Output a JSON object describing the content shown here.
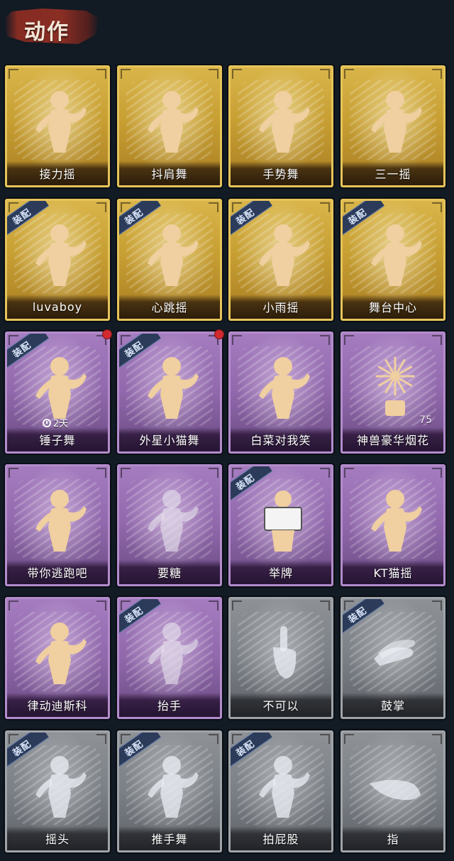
{
  "header": {
    "title": "动作"
  },
  "colors": {
    "gold": "#d9b54a",
    "purple": "#9a72b5",
    "gray": "#868b91",
    "badge": "#2b3b59",
    "alert": "#d12a2f"
  },
  "badge_label": "装配",
  "cards": [
    {
      "label": "接力摇",
      "tier": "gold",
      "equipped": false,
      "icon": "dance-figure-icon"
    },
    {
      "label": "抖肩舞",
      "tier": "gold",
      "equipped": false,
      "icon": "dance-figure-icon"
    },
    {
      "label": "手势舞",
      "tier": "gold",
      "equipped": false,
      "icon": "dance-figure-icon"
    },
    {
      "label": "三一摇",
      "tier": "gold",
      "equipped": false,
      "icon": "dance-figure-icon"
    },
    {
      "label": "luvaboy",
      "tier": "gold",
      "equipped": true,
      "icon": "dance-figure-icon"
    },
    {
      "label": "心跳摇",
      "tier": "gold",
      "equipped": true,
      "icon": "dance-figure-icon"
    },
    {
      "label": "小雨摇",
      "tier": "gold",
      "equipped": true,
      "icon": "dance-figure-icon"
    },
    {
      "label": "舞台中心",
      "tier": "gold",
      "equipped": true,
      "icon": "dance-figure-icon"
    },
    {
      "label": "锤子舞",
      "tier": "purple",
      "equipped": true,
      "new": true,
      "timer": "2天",
      "icon": "dance-figure-icon"
    },
    {
      "label": "外星小猫舞",
      "tier": "purple",
      "equipped": true,
      "new": true,
      "icon": "dance-figure-icon"
    },
    {
      "label": "白菜对我笑",
      "tier": "purple",
      "equipped": false,
      "icon": "dance-figure-icon"
    },
    {
      "label": "神兽豪华烟花",
      "tier": "purple",
      "equipped": false,
      "count": "75",
      "icon": "fireworks-icon"
    },
    {
      "label": "带你逃跑吧",
      "tier": "purple",
      "equipped": false,
      "icon": "dance-figure-icon"
    },
    {
      "label": "要糖",
      "tier": "purple",
      "equipped": false,
      "icon": "figure-silhouette-icon"
    },
    {
      "label": "举牌",
      "tier": "purple",
      "equipped": true,
      "icon": "sign-holding-icon"
    },
    {
      "label": "KT猫摇",
      "tier": "purple",
      "equipped": false,
      "icon": "dance-figure-icon"
    },
    {
      "label": "律动迪斯科",
      "tier": "purple",
      "equipped": false,
      "icon": "dance-figure-icon"
    },
    {
      "label": "抬手",
      "tier": "purple",
      "equipped": true,
      "icon": "figure-silhouette-icon"
    },
    {
      "label": "不可以",
      "tier": "gray",
      "equipped": false,
      "icon": "finger-wag-icon"
    },
    {
      "label": "鼓掌",
      "tier": "gray",
      "equipped": true,
      "icon": "clap-hands-icon"
    },
    {
      "label": "摇头",
      "tier": "gray",
      "equipped": true,
      "icon": "figure-silhouette-icon"
    },
    {
      "label": "推手舞",
      "tier": "gray",
      "equipped": true,
      "icon": "figure-silhouette-icon"
    },
    {
      "label": "拍屁股",
      "tier": "gray",
      "equipped": true,
      "icon": "figure-silhouette-icon"
    },
    {
      "label": "指",
      "tier": "gray",
      "equipped": false,
      "icon": "pointing-hand-icon"
    }
  ]
}
